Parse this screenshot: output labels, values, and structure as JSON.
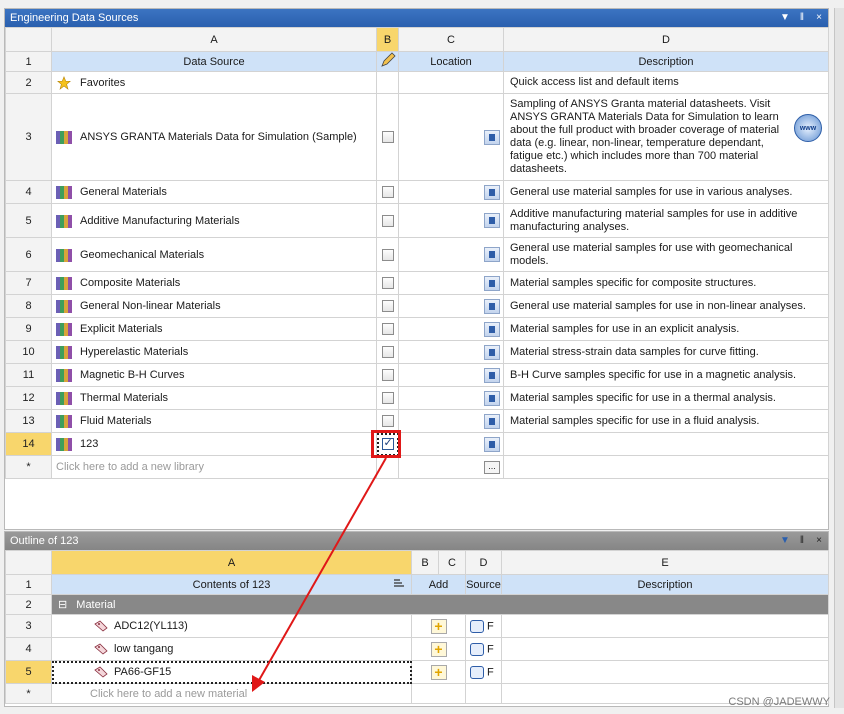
{
  "top_panel": {
    "title": "Engineering Data Sources",
    "controls": [
      "▼",
      "‖",
      "×"
    ],
    "col_letters": [
      "A",
      "B",
      "C",
      "D"
    ],
    "headers": {
      "source": "Data Source",
      "location": "Location",
      "description": "Description"
    },
    "rows": [
      {
        "num": "2",
        "name": "Favorites",
        "icon": "star-icon",
        "has_check": false,
        "has_loc": false,
        "description": "Quick access list and default items"
      },
      {
        "num": "3",
        "name": "ANSYS GRANTA Materials Data for Simulation (Sample)",
        "icon": "library-icon",
        "has_check": true,
        "has_loc": true,
        "description": "Sampling of ANSYS Granta material datasheets. Visit ANSYS GRANTA Materials Data for Simulation to learn about the full product with broader coverage of material data (e.g. linear, non-linear, temperature dependant, fatigue etc.) which includes more than 700 material datasheets."
      },
      {
        "num": "4",
        "name": "General Materials",
        "description": "General use material samples for use in various analyses."
      },
      {
        "num": "5",
        "name": "Additive Manufacturing Materials",
        "description": "Additive manufacturing material samples for use in additive manufacturing analyses."
      },
      {
        "num": "6",
        "name": "Geomechanical Materials",
        "description": "General use material samples for use with geomechanical models."
      },
      {
        "num": "7",
        "name": "Composite Materials",
        "description": "Material samples specific for composite structures."
      },
      {
        "num": "8",
        "name": "General Non-linear Materials",
        "description": "General use material samples for use in non-linear analyses."
      },
      {
        "num": "9",
        "name": "Explicit Materials",
        "description": "Material samples for use in an explicit analysis."
      },
      {
        "num": "10",
        "name": "Hyperelastic Materials",
        "description": "Material stress-strain data samples for curve fitting."
      },
      {
        "num": "11",
        "name": "Magnetic B-H Curves",
        "description": "B-H Curve samples specific for use in a magnetic analysis."
      },
      {
        "num": "12",
        "name": "Thermal Materials",
        "description": "Material samples specific for use in a thermal analysis."
      },
      {
        "num": "13",
        "name": "Fluid Materials",
        "description": "Material samples specific for use in a fluid analysis."
      },
      {
        "num": "14",
        "name": "123",
        "description": "",
        "checked": true
      }
    ],
    "new_row_num": "*",
    "new_row_placeholder": "Click here to add a new library",
    "www_label": "www"
  },
  "bottom_panel": {
    "title": "Outline of 123",
    "controls": [
      "▼",
      "‖",
      "×"
    ],
    "col_letters": [
      "A",
      "B",
      "C",
      "D",
      "E"
    ],
    "headers": {
      "contents": "Contents of 123",
      "add": "Add",
      "source": "Source",
      "description": "Description"
    },
    "group": {
      "num": "2",
      "label": "Material",
      "toggle": "⊟"
    },
    "rows": [
      {
        "num": "3",
        "name": "ADC12(YL113)",
        "src_suffix": "F"
      },
      {
        "num": "4",
        "name": "low tangang",
        "src_suffix": "F"
      },
      {
        "num": "5",
        "name": "PA66-GF15",
        "src_suffix": "F"
      }
    ],
    "new_row_num": "*",
    "new_row_placeholder": "Click here to add a new material"
  },
  "watermark": "CSDN @JADEWWY",
  "colors": {
    "title_active": "#2a5fae",
    "title_inactive": "#858585",
    "header_row": "#cfe2f8",
    "selected_col": "#f8d66c",
    "annotation": "#e01818"
  }
}
